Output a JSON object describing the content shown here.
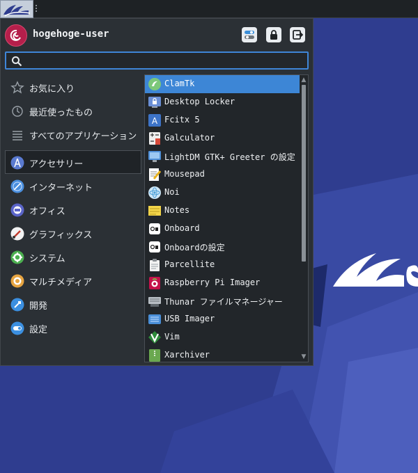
{
  "user": {
    "name": "hogehoge-user"
  },
  "search": {
    "placeholder": "",
    "value": ""
  },
  "categories": [
    {
      "label": "お気に入り"
    },
    {
      "label": "最近使ったもの"
    },
    {
      "label": "すべてのアプリケーション"
    },
    {
      "label": "アクセサリー"
    },
    {
      "label": "インターネット"
    },
    {
      "label": "オフィス"
    },
    {
      "label": "グラフィックス"
    },
    {
      "label": "システム"
    },
    {
      "label": "マルチメディア"
    },
    {
      "label": "開発"
    },
    {
      "label": "設定"
    }
  ],
  "selected_category": "アクセサリー",
  "apps": [
    {
      "label": "ClamTk"
    },
    {
      "label": "Desktop Locker"
    },
    {
      "label": "Fcitx 5"
    },
    {
      "label": "Galculator"
    },
    {
      "label": "LightDM GTK+ Greeter の設定"
    },
    {
      "label": "Mousepad"
    },
    {
      "label": "Noi"
    },
    {
      "label": "Notes"
    },
    {
      "label": "Onboard"
    },
    {
      "label": "Onboardの設定"
    },
    {
      "label": "Parcellite"
    },
    {
      "label": "Raspberry Pi Imager"
    },
    {
      "label": "Thunar ファイルマネージャー"
    },
    {
      "label": "USB Imager"
    },
    {
      "label": "Vim"
    },
    {
      "label": "Xarchiver"
    }
  ],
  "selected_app": "ClamTk",
  "colors": {
    "accent": "#3d86d6",
    "menu_bg": "#2b3035",
    "desktop": "#2f3d8f"
  }
}
